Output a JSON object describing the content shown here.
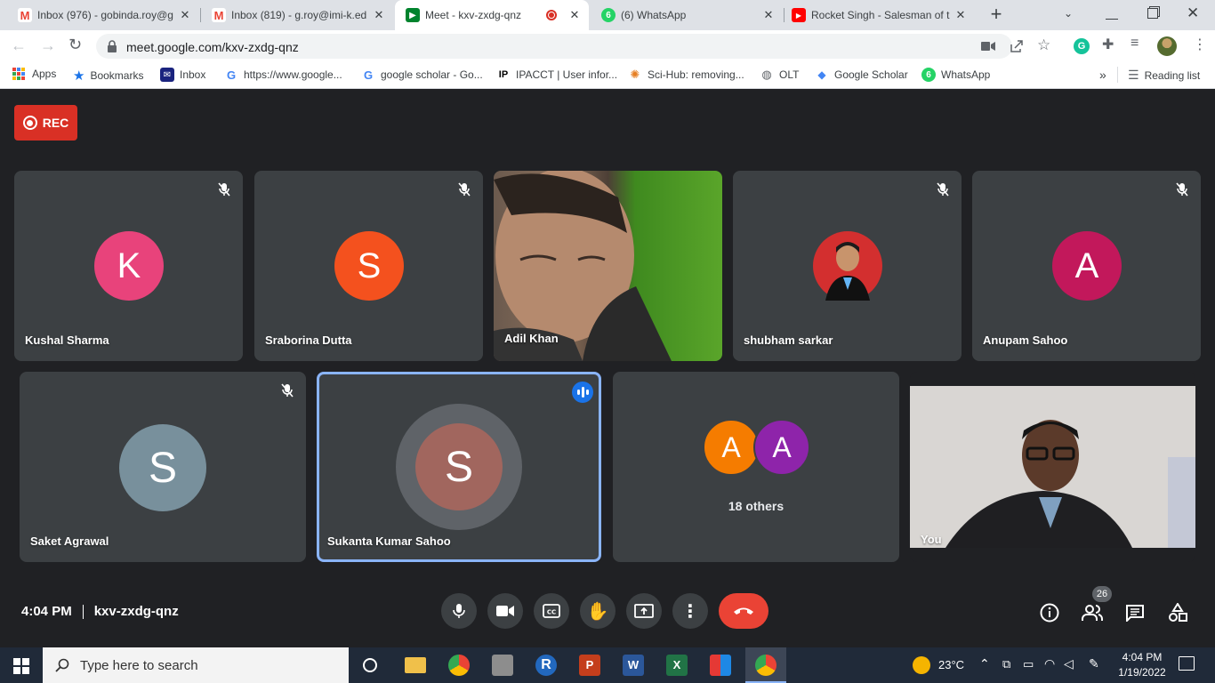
{
  "browser": {
    "tabs": [
      {
        "title": "Inbox (976) - gobinda.roy@g",
        "icon": "gmail-icon"
      },
      {
        "title": "Inbox (819) - g.roy@imi-k.ed",
        "icon": "gmail-icon"
      },
      {
        "title": "Meet - kxv-zxdg-qnz",
        "icon": "meet-icon",
        "active": true
      },
      {
        "title": "(6) WhatsApp",
        "icon": "whatsapp-icon"
      },
      {
        "title": "Rocket Singh - Salesman of t",
        "icon": "youtube-icon"
      }
    ],
    "url": "meet.google.com/kxv-zxdg-qnz",
    "bookmarks": [
      {
        "label": "Apps"
      },
      {
        "label": "Bookmarks"
      },
      {
        "label": "Inbox"
      },
      {
        "label": "https://www.google..."
      },
      {
        "label": "google scholar - Go..."
      },
      {
        "label": "IPACCT | User infor..."
      },
      {
        "label": "Sci-Hub: removing..."
      },
      {
        "label": "OLT"
      },
      {
        "label": "Google Scholar"
      },
      {
        "label": "WhatsApp"
      }
    ],
    "more_bookmarks": "»",
    "reading_list": "Reading list"
  },
  "meet": {
    "rec_label": "REC",
    "participants": [
      {
        "name": "Kushal Sharma",
        "initial": "K",
        "color": "#e8437b",
        "muted": true
      },
      {
        "name": "Sraborina Dutta",
        "initial": "S",
        "color": "#f4511e",
        "muted": true
      },
      {
        "name": "Adil Khan",
        "video": true
      },
      {
        "name": "shubham sarkar",
        "photo": true,
        "muted": true
      },
      {
        "name": "Anupam Sahoo",
        "initial": "A",
        "color": "#c2185b",
        "muted": true
      },
      {
        "name": "Saket Agrawal",
        "initial": "S",
        "color": "#78909c",
        "muted": true
      },
      {
        "name": "Sukanta Kumar Sahoo",
        "initial": "S",
        "color": "#a1665e",
        "speaking": true
      },
      {
        "name": "You",
        "video": true
      }
    ],
    "others": {
      "label": "18 others",
      "initials": [
        "A",
        "A"
      ],
      "colors": [
        "#f57c00",
        "#8e24aa"
      ]
    },
    "time": "4:04 PM",
    "meeting_code": "kxv-zxdg-qnz",
    "participant_count": "26"
  },
  "taskbar": {
    "search_placeholder": "Type here to search",
    "temperature": "23°C",
    "time": "4:04 PM",
    "date": "1/19/2022"
  }
}
